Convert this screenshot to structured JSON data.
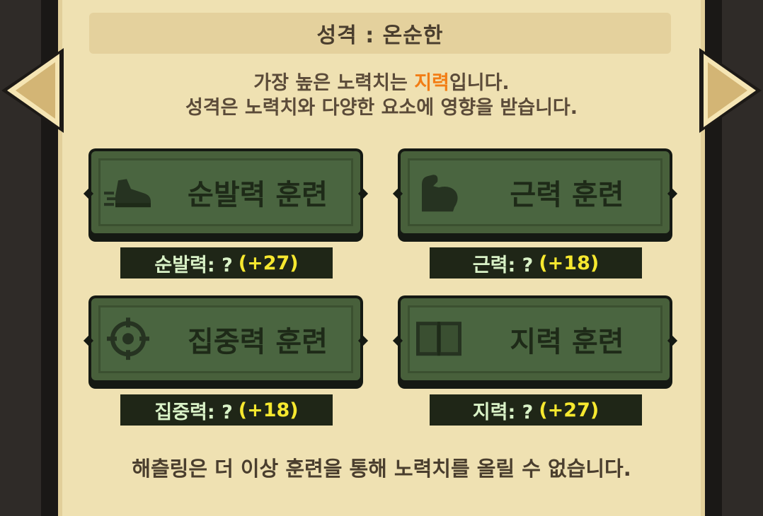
{
  "header": {
    "title": "성격 : 온순한"
  },
  "info": {
    "line1_prefix": "가장 높은 노력치는 ",
    "line1_highlight": "지력",
    "line1_suffix": "입니다.",
    "line2": "성격은 노력치와 다양한 요소에 영향을 받습니다."
  },
  "trainings": [
    {
      "icon": "shoe-icon",
      "label": "순발력 훈련",
      "stat_name": "순발력: ?",
      "stat_gain": "(+27)"
    },
    {
      "icon": "muscle-arm-icon",
      "label": "근력 훈련",
      "stat_name": "근력: ?",
      "stat_gain": "(+18)"
    },
    {
      "icon": "crosshair-icon",
      "label": "집중력 훈련",
      "stat_name": "집중력: ?",
      "stat_gain": "(+18)"
    },
    {
      "icon": "book-icon",
      "label": "지력 훈련",
      "stat_name": "지력: ?",
      "stat_gain": "(+27)"
    }
  ],
  "footer": {
    "message": "해츨링은 더 이상 훈련을 통해 노력치를 올릴 수 없습니다."
  },
  "colors": {
    "highlight": "#f27d15",
    "gain": "#f6e82f",
    "button_green": "#4a6540",
    "panel": "#efe1b2"
  }
}
